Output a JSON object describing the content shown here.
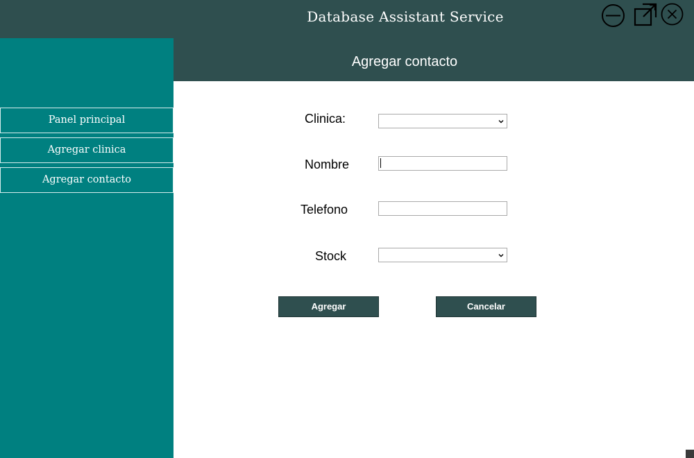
{
  "window": {
    "title": "Database Assistant Service",
    "controls": {
      "minimize_icon": "minimize-circle-icon",
      "maximize_icon": "maximize-icon",
      "close_icon": "close-circle-icon"
    }
  },
  "colors": {
    "titlebar": "#2f4f4f",
    "sidebar": "#008080",
    "header": "#2f4f4f",
    "button": "#2f4f4f",
    "content": "#ffffff"
  },
  "sidebar": {
    "items": [
      {
        "label": "Panel principal"
      },
      {
        "label": "Agregar clinica"
      },
      {
        "label": "Agregar contacto"
      }
    ]
  },
  "header": {
    "title": "Agregar contacto"
  },
  "form": {
    "clinica": {
      "label": "Clinica:",
      "value": ""
    },
    "nombre": {
      "label": "Nombre",
      "value": ""
    },
    "telefono": {
      "label": "Telefono",
      "value": ""
    },
    "stock": {
      "label": "Stock",
      "value": ""
    }
  },
  "buttons": {
    "agregar": "Agregar",
    "cancelar": "Cancelar"
  }
}
